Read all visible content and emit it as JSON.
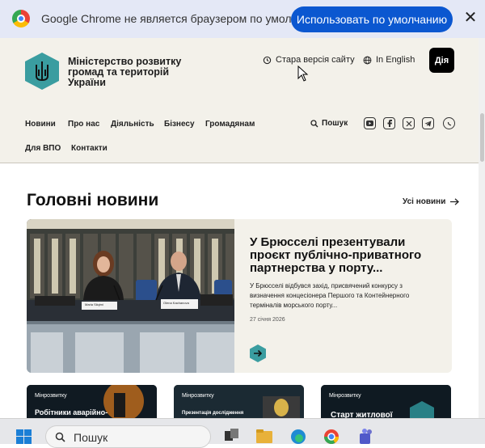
{
  "banner": {
    "message": "Google Chrome не является браузером по умолча...",
    "button_label": "Использовать по умолчанию",
    "close_symbol": "✕"
  },
  "header": {
    "ministry_name": "Міністерство розвитку громад та територій України",
    "old_version_label": "Стара версія сайту",
    "english_label": "In English",
    "diia_label": "Дія"
  },
  "nav": {
    "items": [
      "Новини",
      "Про нас",
      "Діяльність",
      "Бізнесу",
      "Громадянам",
      "Для ВПО",
      "Контакти"
    ],
    "search_label": "Пошук",
    "social": [
      "youtube-icon",
      "facebook-icon",
      "x-icon",
      "telegram-icon",
      "whatsapp-icon"
    ]
  },
  "main": {
    "section_title": "Головні новини",
    "all_news_label": "Усі новини",
    "featured": {
      "title": "У Брюсселі презентували проєкт публічно-приватного партнерства у порту...",
      "description": "У Брюсселі відбувся захід, присвячений конкурсу з визначення концесіонера Першого та Контейнерного терміналів морського порту...",
      "date": "27 січня 2026",
      "nameplate_left": "Maria Siiqimi",
      "nameplate_right": "Olena Kachanova"
    },
    "mini_cards": [
      {
        "label": "Мінрозвитку",
        "title": "Робітники аварійно-"
      },
      {
        "label": "Мінрозвитку",
        "title": "Презентація дослідження"
      },
      {
        "label": "Мінрозвитку",
        "title": "Старт житлової"
      }
    ]
  },
  "taskbar": {
    "search_placeholder": "Пошук"
  },
  "colors": {
    "banner_bg": "#e4e8f6",
    "primary_button": "#0b57d0",
    "site_bg": "#f3f1ea",
    "accent_teal": "#3a9da0"
  }
}
